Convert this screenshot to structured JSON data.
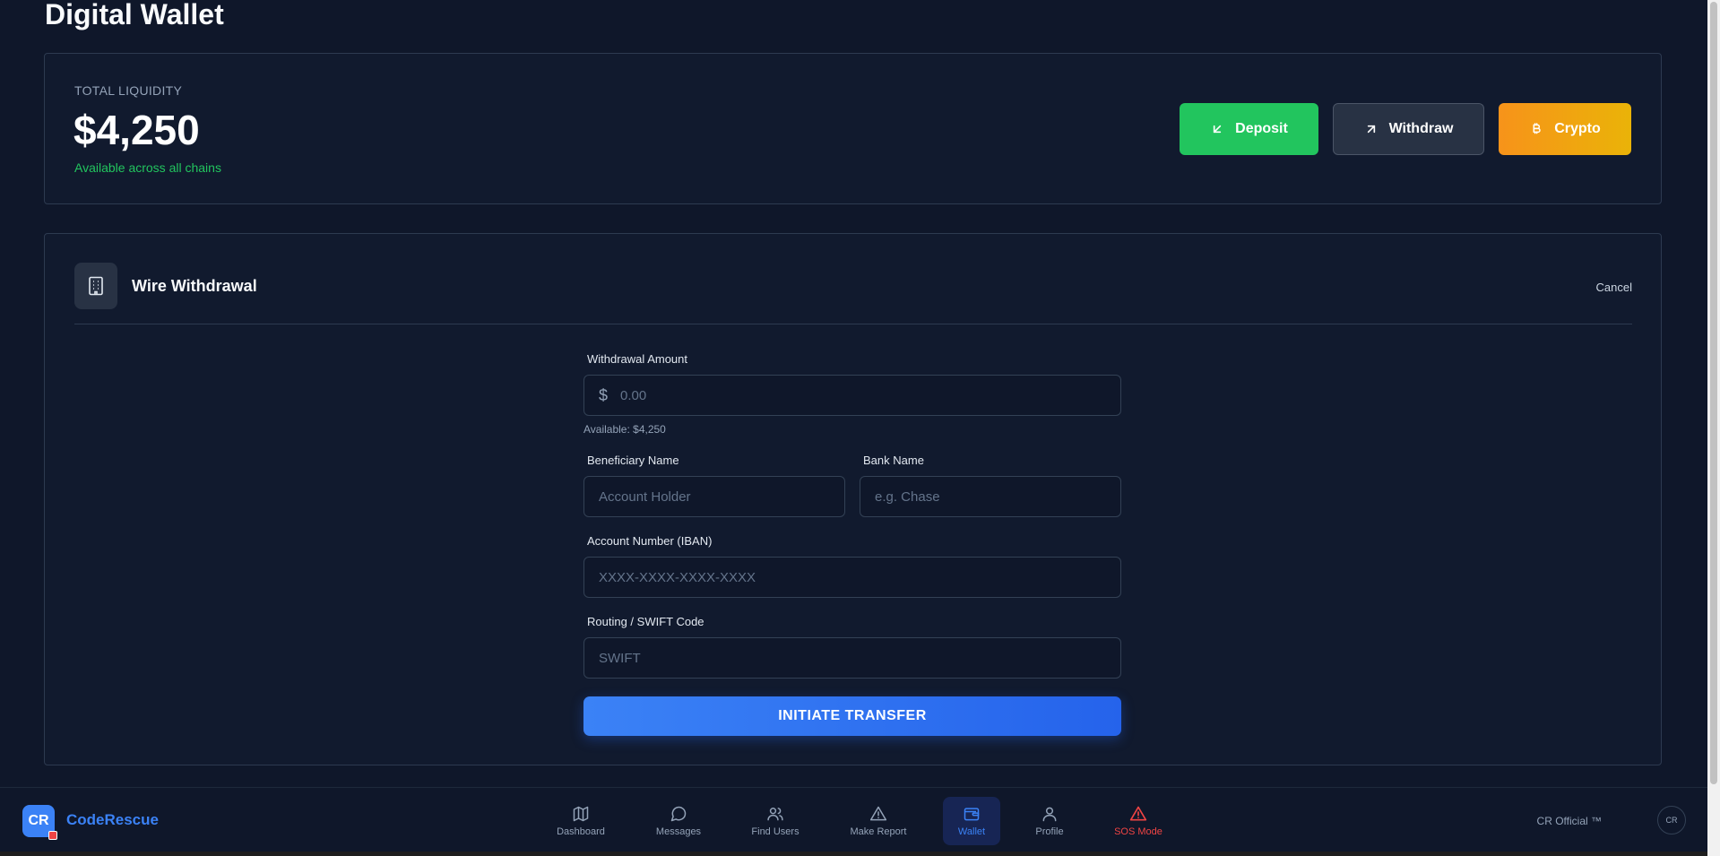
{
  "page": {
    "title": "Digital Wallet"
  },
  "liquidity": {
    "label": "TOTAL LIQUIDITY",
    "value": "$4,250",
    "subtitle": "Available across all chains"
  },
  "actions": {
    "deposit": "Deposit",
    "withdraw": "Withdraw",
    "crypto": "Crypto"
  },
  "wire": {
    "title": "Wire Withdrawal",
    "cancel": "Cancel",
    "amount_label": "Withdrawal Amount",
    "currency_symbol": "$",
    "amount_placeholder": "0.00",
    "available_hint": "Available: $4,250",
    "beneficiary_label": "Beneficiary Name",
    "beneficiary_placeholder": "Account Holder",
    "bank_label": "Bank Name",
    "bank_placeholder": "e.g. Chase",
    "iban_label": "Account Number (IBAN)",
    "iban_placeholder": "XXXX-XXXX-XXXX-XXXX",
    "swift_label": "Routing / SWIFT Code",
    "swift_placeholder": "SWIFT",
    "submit": "INITIATE TRANSFER"
  },
  "nav": {
    "brand_initials": "CR",
    "brand_name": "CodeRescue",
    "items": [
      {
        "label": "Dashboard",
        "icon": "map-icon"
      },
      {
        "label": "Messages",
        "icon": "message-icon"
      },
      {
        "label": "Find Users",
        "icon": "users-icon"
      },
      {
        "label": "Make Report",
        "icon": "warning-icon"
      },
      {
        "label": "Wallet",
        "icon": "wallet-icon",
        "active": true
      },
      {
        "label": "Profile",
        "icon": "user-icon"
      },
      {
        "label": "SOS Mode",
        "icon": "alert-icon"
      }
    ],
    "official": "CR Official ™",
    "avatar_initials": "CR"
  },
  "colors": {
    "background": "#0f172a",
    "deposit": "#22c55e",
    "crypto": "#f7931a",
    "accent": "#3b82f6",
    "sos": "#ef4444"
  }
}
